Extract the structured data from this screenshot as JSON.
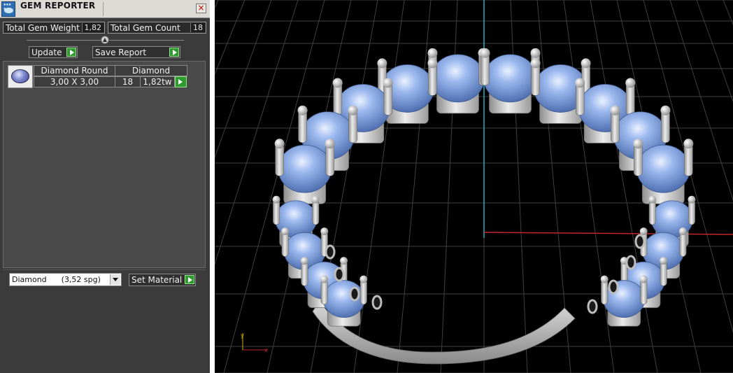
{
  "window": {
    "title": "GEM REPORTER",
    "close_glyph": "×",
    "icon": "gem-reporter-app-icon"
  },
  "summary": {
    "total_weight_label": "Total Gem Weight",
    "total_weight_value": "1,82",
    "total_count_label": "Total Gem Count",
    "total_count_value": "18"
  },
  "actions": {
    "update_label": "Update",
    "save_report_label": "Save Report"
  },
  "gems": [
    {
      "shape": "Diamond Round",
      "material": "Diamond",
      "size": "3,00 X 3,00",
      "count": "18",
      "weight": "1,82tw"
    }
  ],
  "material_select": {
    "value": "Diamond      (3,52 spg)"
  },
  "set_material_label": "Set Material",
  "colors": {
    "panel_bg": "#3b3b3b",
    "play_green": "#2f9a2f",
    "viewport_bg": "#000000",
    "grid": "#3f3f3f",
    "axis_x": "#c0262a",
    "axis_y": "#1fb3c0",
    "gem_blue": "#7ea3e0",
    "metal": "#c8c8c8"
  }
}
